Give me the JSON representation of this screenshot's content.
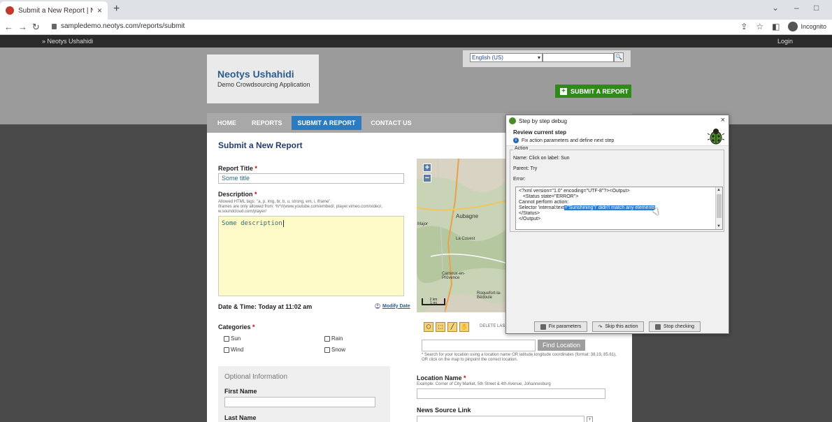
{
  "browser": {
    "tab_title": "Submit a New Report | Neotys Us",
    "tab_close": "×",
    "new_tab": "+",
    "url": "sampledemo.neotys.com/reports/submit",
    "incognito_label": "Incognito",
    "win_min": "–",
    "win_max": "□",
    "win_chevron": "⌄"
  },
  "site": {
    "brand_bar": "» Neotys Ushahidi",
    "login": "Login",
    "logo_title": "Neotys Ushahidi",
    "logo_subtitle": "Demo Crowdsourcing Application",
    "language": "English (US)",
    "submit_report_button": "SUBMIT A REPORT"
  },
  "nav": {
    "items": [
      {
        "label": "HOME",
        "active": false
      },
      {
        "label": "REPORTS",
        "active": false
      },
      {
        "label": "SUBMIT A REPORT",
        "active": true
      },
      {
        "label": "CONTACT US",
        "active": false
      }
    ]
  },
  "form": {
    "heading": "Submit a New Report",
    "title_label": "Report Title",
    "required_mark": "*",
    "title_value": "Some title",
    "description_label": "Description",
    "description_hint": "Allowed HTML tags: \"a, p, img, br, b, u, strong, em, i, iframe\".\niframes are only allowed from: %^//(www.youtube.com/embed/, player.vimeo.com/video/,\nw.soundcloud.com/player/",
    "description_value": "Some description",
    "datetime_label": "Date & Time: Today at 11:02 am",
    "modify_date": "Modify Date",
    "categories_label": "Categories",
    "categories": [
      "Sun",
      "Rain",
      "Wind",
      "Snow"
    ],
    "optional_heading": "Optional Information",
    "first_name_label": "First Name",
    "last_name_label": "Last Name",
    "location_name_label": "Location Name",
    "location_name_hint": "Example: Corner of City Market, 5th Street & 4th Avenue, Johannesburg",
    "news_source_label": "News Source Link",
    "delete_last": "DELETE LAS",
    "find_location": "Find Location",
    "find_location_hint": "* Search for your location using a location name OR latitude,longitude coordinates (format: 38.19, 85.61), OR click on the map to pinpoint the correct location."
  },
  "map": {
    "labels": [
      "Aubagne",
      "La Couest",
      "Carnoux-en-Provence",
      "Roquefort-la-Bédoule",
      "Major"
    ],
    "scale": "2 km\n1 mi"
  },
  "dialog": {
    "title": "Step by step debug",
    "close": "×",
    "subtitle": "Review current step",
    "instruction": "Fix action parameters and define next step",
    "action_legend": "Action",
    "name_line": "Name: Click on label: Sun",
    "parent_line": "Parent: Try",
    "error_label": "Error:",
    "error_lines": [
      "<?xml version=\"1.0\" encoding=\"UTF-8\"?><Output>",
      "   <Status state=\"ERROR\">",
      "Cannot perform action:",
      "Selector 'internal:text",
      "</Status>",
      "</Output>"
    ],
    "error_highlight": "=\"Sunshining\"i' didn't match any elements",
    "fix_button": "Fix parameters",
    "skip_button": "Skip this action",
    "stop_button": "Stop checking"
  }
}
